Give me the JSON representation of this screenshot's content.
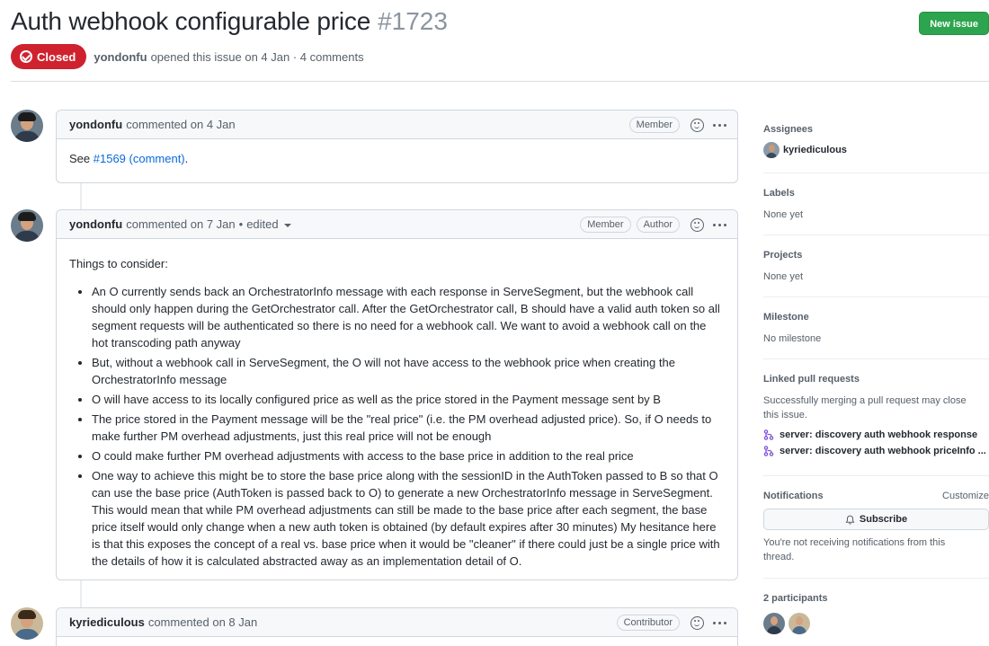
{
  "header": {
    "title": "Auth webhook configurable price",
    "issue_number": "#1723",
    "new_issue_label": "New issue"
  },
  "meta": {
    "state_label": "Closed",
    "author": "yondonfu",
    "summary": "opened this issue on 4 Jan · 4 comments"
  },
  "comments": [
    {
      "author": "yondonfu",
      "action": "commented on 4 Jan",
      "roles": [
        "Member"
      ],
      "body_prefix": "See ",
      "body_link": "#1569 (comment)",
      "body_suffix": "."
    },
    {
      "author": "yondonfu",
      "action": "commented on 7 Jan",
      "edited": "edited",
      "roles": [
        "Member",
        "Author"
      ],
      "intro": "Things to consider:",
      "bullets": [
        "An O currently sends back an OrchestratorInfo message with each response in ServeSegment, but the webhook call should only happen during the GetOrchestrator call. After the GetOrchestrator call, B should have a valid auth token so all segment requests will be authenticated so there is no need for a webhook call. We want to avoid a webhook call on the hot transcoding path anyway",
        "But, without a webhook call in ServeSegment, the O will not have access to the webhook price when creating the OrchestratorInfo message",
        "O will have access to its locally configured price as well as the price stored in the Payment message sent by B",
        "The price stored in the Payment message will be the \"real price\" (i.e. the PM overhead adjusted price). So, if O needs to make further PM overhead adjustments, just this real price will not be enough",
        "O could make further PM overhead adjustments with access to the base price in addition to the real price",
        "One way to achieve this might be to store the base price along with the sessionID in the AuthToken passed to B so that O can use the base price (AuthToken is passed back to O) to generate a new OrchestratorInfo message in ServeSegment. This would mean that while PM overhead adjustments can still be made to the base price after each segment, the base price itself would only change when a new auth token is obtained (by default expires after 30 minutes) My hesitance here is that this exposes the concept of a real vs. base price when it would be \"cleaner\" if there could just be a single price with the details of how it is calculated abstracted away as an implementation detail of O."
      ]
    },
    {
      "author": "kyriediculous",
      "action": "commented on 8 Jan",
      "roles": [
        "Contributor"
      ]
    }
  ],
  "sidebar": {
    "assignees": {
      "heading": "Assignees",
      "name": "kyriediculous"
    },
    "labels": {
      "heading": "Labels",
      "value": "None yet"
    },
    "projects": {
      "heading": "Projects",
      "value": "None yet"
    },
    "milestone": {
      "heading": "Milestone",
      "value": "No milestone"
    },
    "linked_prs": {
      "heading": "Linked pull requests",
      "description": "Successfully merging a pull request may close this issue.",
      "items": [
        "server: discovery auth webhook response",
        "server: discovery auth webhook priceInfo ..."
      ]
    },
    "notifications": {
      "heading": "Notifications",
      "customize": "Customize",
      "subscribe": "Subscribe",
      "note": "You're not receiving notifications from this thread."
    },
    "participants": {
      "heading": "2 participants"
    }
  },
  "colors": {
    "closed": "#cf222e",
    "new_issue": "#2da44e",
    "link": "#0969da",
    "pr_icon": "#8250df"
  }
}
